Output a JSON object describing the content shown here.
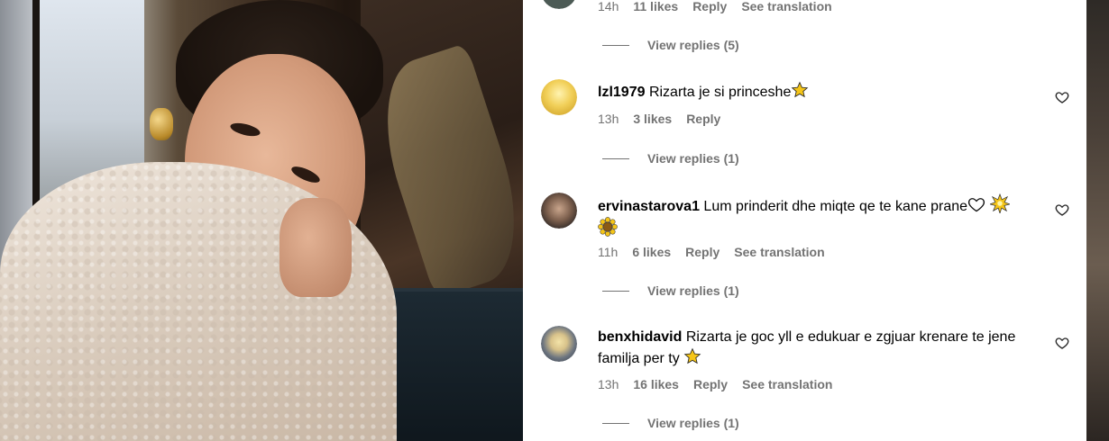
{
  "top_comment": {
    "time": "14h",
    "likes": "11 likes",
    "reply": "Reply",
    "see_translation": "See translation",
    "view_replies": "View replies (5)"
  },
  "comments": [
    {
      "username": "lzl1979",
      "text": "Rizarta je si princeshe",
      "emoji": "star-emoji",
      "time": "13h",
      "likes": "3 likes",
      "reply": "Reply",
      "view_replies": "View replies (1)"
    },
    {
      "username": "ervinastarova1",
      "text": "Lum prinderit dhe miqte qe te kane prane",
      "emoji": "heart-outline, sparkle-star, sunflower",
      "time": "11h",
      "likes": "6 likes",
      "reply": "Reply",
      "see_translation": "See translation",
      "view_replies": "View replies (1)"
    },
    {
      "username": "benxhidavid",
      "text": "Rizarta je goc yll e edukuar e zgjuar krenare te jene familja per ty",
      "emoji": "star-emoji",
      "time": "13h",
      "likes": "16 likes",
      "reply": "Reply",
      "see_translation": "See translation",
      "view_replies": "View replies (1)"
    }
  ],
  "colors": {
    "meta_text": "#737373",
    "star": "#f5c518"
  }
}
